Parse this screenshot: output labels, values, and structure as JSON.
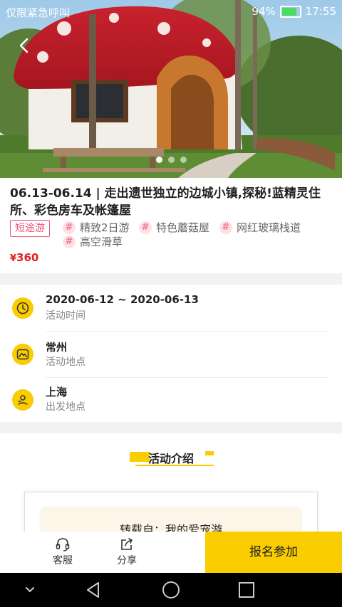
{
  "status_bar": {
    "carrier": "仅限紧急呼叫",
    "battery": "94%",
    "time": "17:55"
  },
  "hero": {
    "image_icon": "mushroom-house-photo",
    "back_icon": "chevron-left-icon",
    "carousel_total": 3,
    "carousel_active": 1
  },
  "activity": {
    "title": "06.13-06.14 | 走出遗世独立的边城小镇,探秘!蓝精灵住所、彩色房车及帐篷屋",
    "category_tag": "短途游",
    "tags": [
      "精致2日游",
      "特色蘑菇屋",
      "网红玻璃栈道",
      "高空滑草"
    ],
    "price_currency": "¥",
    "price": "360"
  },
  "details": {
    "time": {
      "value": "2020-06-12 ~ 2020-06-13",
      "label": "活动时间",
      "icon": "clock-icon"
    },
    "location": {
      "value": "常州",
      "label": "活动地点",
      "icon": "mountain-icon"
    },
    "departure": {
      "value": "上海",
      "label": "出发地点",
      "icon": "departure-icon"
    }
  },
  "intro": {
    "section_title": "活动介绍",
    "repost_text": "转载自：我的爱宠游"
  },
  "bottom_bar": {
    "service_label": "客服",
    "share_label": "分享",
    "signup_label": "报名参加"
  },
  "colors": {
    "accent": "#f9cd00",
    "price": "#e02020",
    "tag": "#e8577f"
  }
}
